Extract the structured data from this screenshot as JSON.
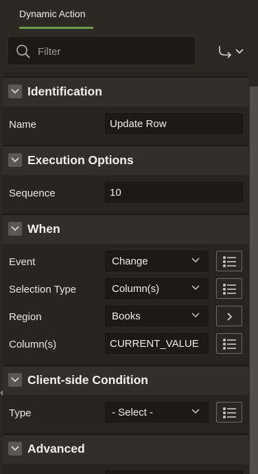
{
  "tab": {
    "label": "Dynamic Action"
  },
  "search": {
    "placeholder": "Filter"
  },
  "colors": {
    "accent": "#6e9a4e",
    "background": "#2c2925",
    "field": "#1b1a18"
  },
  "sections": {
    "identification": {
      "title": "Identification",
      "name_label": "Name",
      "name_value": "Update Row"
    },
    "execution": {
      "title": "Execution Options",
      "sequence_label": "Sequence",
      "sequence_value": "10"
    },
    "when": {
      "title": "When",
      "event_label": "Event",
      "event_value": "Change",
      "selection_type_label": "Selection Type",
      "selection_type_value": "Column(s)",
      "region_label": "Region",
      "region_value": "Books",
      "columns_label": "Column(s)",
      "columns_value": "CURRENT_VALUE"
    },
    "client_condition": {
      "title": "Client-side Condition",
      "type_label": "Type",
      "type_value": "- Select -"
    },
    "advanced": {
      "title": "Advanced"
    }
  }
}
